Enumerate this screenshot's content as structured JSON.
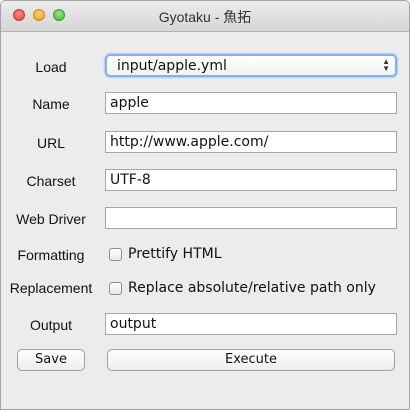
{
  "window": {
    "title": "Gyotaku - 魚拓"
  },
  "form": {
    "load": {
      "label": "Load",
      "value": "input/apple.yml"
    },
    "name": {
      "label": "Name",
      "value": "apple"
    },
    "url": {
      "label": "URL",
      "value": "http://www.apple.com/"
    },
    "charset": {
      "label": "Charset",
      "value": "UTF-8"
    },
    "web_driver": {
      "label": "Web Driver",
      "value": ""
    },
    "formatting": {
      "label": "Formatting",
      "option": "Prettify HTML",
      "checked": false
    },
    "replacement": {
      "label": "Replacement",
      "option": "Replace absolute/relative path only",
      "checked": false
    },
    "output": {
      "label": "Output",
      "value": "output"
    }
  },
  "buttons": {
    "save": "Save",
    "execute": "Execute"
  },
  "icons": {
    "close": "close-icon",
    "minimize": "minimize-icon",
    "maximize": "maximize-icon",
    "select_arrows": "up-down-arrows-icon"
  },
  "colors": {
    "close": "#e0443a",
    "minimize": "#e0a120",
    "maximize": "#48b43a",
    "focus": "#7fb2f2"
  }
}
